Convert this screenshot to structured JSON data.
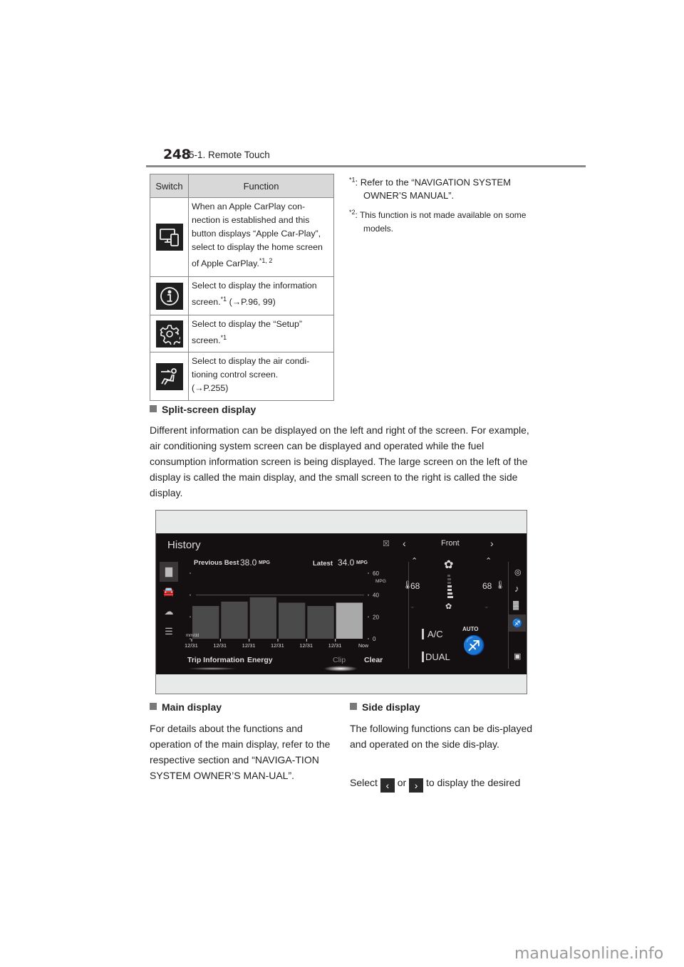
{
  "header": {
    "page_number": "248",
    "section": "5-1. Remote Touch"
  },
  "switch_table": {
    "headers": [
      "Switch",
      "Function"
    ],
    "rows": [
      {
        "icon": "apple-carplay-icon",
        "text": "When an Apple CarPlay con-nection is established and this button displays “Apple Car-Play”, select to display the home screen of Apple CarPlay.",
        "sup": "*1, 2",
        "ref": ""
      },
      {
        "icon": "info-icon",
        "text": "Select to display the information screen.",
        "sup": "*1",
        "ref": " (→P.96, 99)"
      },
      {
        "icon": "gear-icon",
        "text": "Select to display the “Setup” screen.",
        "sup": "*1",
        "ref": ""
      },
      {
        "icon": "air-conditioning-seat-icon",
        "text": "Select to display the air condi-tioning control screen.",
        "sup": "",
        "ref": "(→P.255)"
      }
    ]
  },
  "footnotes": [
    {
      "mark": "*1",
      "text": "Refer to the “NAVIGATION SYSTEM OWNER’S MANUAL”."
    },
    {
      "mark": "*2",
      "text": "This function is not made available on some models."
    }
  ],
  "split_screen": {
    "heading": "Split-screen display",
    "body": "Different information can be displayed on the left and right of the screen. For example, air conditioning system screen can be displayed and operated while the fuel consumption information screen is being displayed. The large screen on the left of the display is called the main display, and the small screen to the right is called the side display."
  },
  "screen": {
    "title": "History",
    "previous_best_label": "Previous Best",
    "previous_best_value": "38.0",
    "latest_label": "Latest",
    "latest_value": "34.0",
    "unit": "MPG",
    "date_format_label": "mm/dd",
    "bottom_buttons": [
      "Trip Information",
      "Energy",
      "Clip",
      "Clear"
    ],
    "side": {
      "zone_label": "Front",
      "left_temp": "68",
      "right_temp": "68",
      "ac_label": "A/C",
      "dual_label": "DUAL",
      "auto_label": "AUTO",
      "fan_level_fraction": 0.5
    }
  },
  "chart_data": {
    "type": "bar",
    "title": "History",
    "categories": [
      "12/31",
      "12/31",
      "12/31",
      "12/31",
      "12/31",
      "12/31"
    ],
    "x_end_label": "Now",
    "values": [
      30,
      34,
      38,
      33,
      30,
      33
    ],
    "highlight_index": 5,
    "xlabel": "mm/dd",
    "ylabel": "MPG",
    "ylim": [
      0,
      60
    ],
    "yticks": [
      0,
      20,
      40,
      60
    ],
    "grid": true,
    "colors": {
      "bar": "#4a4a4a",
      "current_bar": "#a9a9a9"
    }
  },
  "main_display": {
    "heading": "Main display",
    "body": "For details about the functions and operation of the main display, refer to the respective section and “NAVIGA-TION SYSTEM OWNER’S MAN-UAL”."
  },
  "side_display": {
    "heading": "Side display",
    "body": "The following functions can be dis-played and operated on the side dis-play.",
    "select_prefix": "Select",
    "select_or": "or",
    "select_suffix": "to display the desired"
  },
  "watermark": "manualsonline.info"
}
